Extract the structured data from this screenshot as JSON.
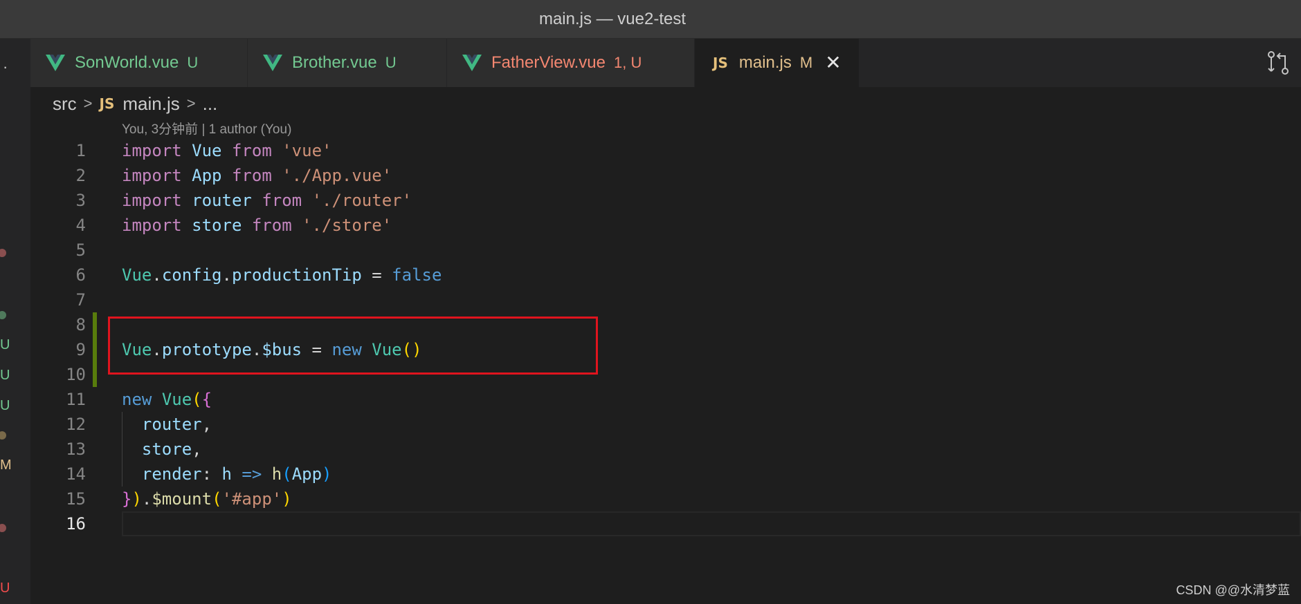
{
  "window": {
    "title": "main.js — vue2-test"
  },
  "activity_marks": [
    {
      "text": "U",
      "color": "#73c991"
    },
    {
      "text": "U",
      "color": "#73c991"
    },
    {
      "text": "U",
      "color": "#73c991"
    },
    {
      "text": "M",
      "color": "#e2c08d"
    },
    {
      "text": "U",
      "color": "#f14c4c"
    }
  ],
  "tabs": [
    {
      "icon": "vue-icon",
      "name": "SonWorld.vue",
      "badge": "U",
      "name_color": "#73c991",
      "badge_color": "#73c991"
    },
    {
      "icon": "vue-icon",
      "name": "Brother.vue",
      "badge": "U",
      "name_color": "#73c991",
      "badge_color": "#73c991"
    },
    {
      "icon": "vue-icon",
      "name": "FatherView.vue",
      "badge": "1, U",
      "name_color": "#f48771",
      "badge_color": "#f48771"
    },
    {
      "icon": "js-icon",
      "icon_text": "JS",
      "name": "main.js",
      "badge": "M",
      "name_color": "#e2c08d",
      "badge_color": "#e2c08d",
      "active": true,
      "close": "✕"
    }
  ],
  "breadcrumb": {
    "folder": "src",
    "file_icon": "JS",
    "file": "main.js",
    "symbol": "..."
  },
  "codelens": "You, 3分钟前 | 1 author (You)",
  "line_numbers": [
    "1",
    "2",
    "3",
    "4",
    "5",
    "6",
    "7",
    "8",
    "9",
    "10",
    "11",
    "12",
    "13",
    "14",
    "15",
    "16"
  ],
  "code": {
    "l1": [
      "import",
      " ",
      "Vue",
      " ",
      "from",
      " ",
      "'vue'"
    ],
    "l2": [
      "import",
      " ",
      "App",
      " ",
      "from",
      " ",
      "'./App.vue'"
    ],
    "l3": [
      "import",
      " ",
      "router",
      " ",
      "from",
      " ",
      "'./router'"
    ],
    "l4": [
      "import",
      " ",
      "store",
      " ",
      "from",
      " ",
      "'./store'"
    ],
    "l6": [
      "Vue",
      ".",
      "config",
      ".",
      "productionTip",
      " = ",
      "false"
    ],
    "l9": [
      "Vue",
      ".",
      "prototype",
      ".",
      "$bus",
      " = ",
      "new",
      " ",
      "Vue",
      "()"
    ],
    "l11": [
      "new",
      " ",
      "Vue",
      "(",
      "{"
    ],
    "l12": [
      "  ",
      "router",
      ","
    ],
    "l13": [
      "  ",
      "store",
      ","
    ],
    "l14": [
      "  ",
      "render",
      ": ",
      "h",
      " ",
      "=>",
      " ",
      "h",
      "(",
      "App",
      ")"
    ],
    "l15": [
      "}",
      ")",
      ".",
      "$mount",
      "(",
      "'#app'",
      ")"
    ]
  },
  "watermark": "CSDN @@水清梦蓝",
  "colors": {
    "highlight_box": "#e0141e",
    "git_modified_gutter": "#587c0c",
    "editor_bg": "#1e1e1e"
  }
}
